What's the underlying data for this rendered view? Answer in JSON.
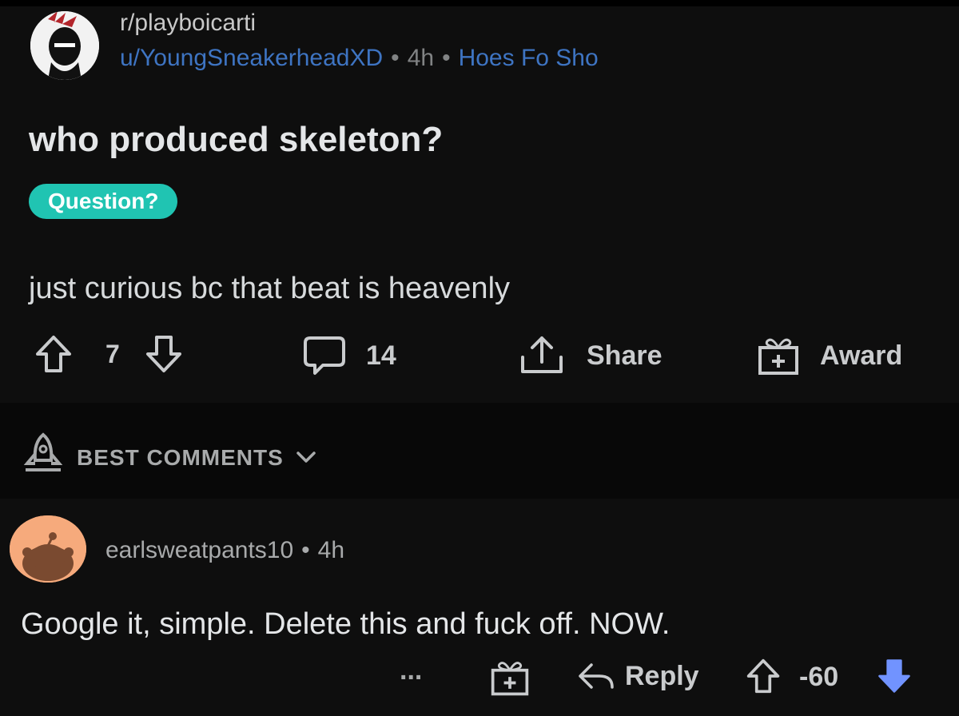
{
  "post": {
    "subreddit": "r/playboicarti",
    "author": "u/YoungSneakerheadXD",
    "separator": "•",
    "age": "4h",
    "user_flair": "Hoes Fo Sho",
    "title": "who produced skeleton?",
    "post_flair": "Question?",
    "body": "just curious bc that beat is heavenly",
    "score": "7",
    "comments_count": "14",
    "share_label": "Share",
    "award_label": "Award"
  },
  "sort": {
    "label": "BEST COMMENTS"
  },
  "comment": {
    "author": "earlsweatpants10",
    "separator": "•",
    "age": "4h",
    "text": "Google it, simple. Delete this and fuck off. NOW.",
    "more_label": "...",
    "reply_label": "Reply",
    "score": "-60"
  },
  "icons": {
    "upvote": "arrow-up-outline-icon",
    "downvote": "arrow-down-outline-icon",
    "comment": "speech-bubble-icon",
    "share": "share-icon",
    "award": "gift-icon",
    "sort": "rocket-icon",
    "chevron": "chevron-down-icon",
    "reply": "reply-arrow-icon",
    "downvoted": "arrow-down-filled-icon"
  },
  "colors": {
    "background": "#0e0e0e",
    "link": "#3e74c2",
    "flair": "#20c4b2",
    "downvoted": "#7193ff",
    "comment_avatar": "#f6aa7c"
  }
}
